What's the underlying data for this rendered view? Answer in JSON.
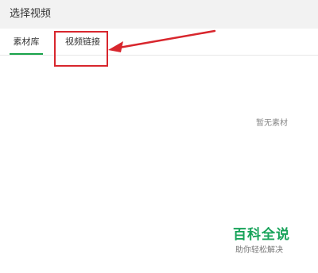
{
  "dialog": {
    "title": "选择视频"
  },
  "tabs": [
    {
      "label": "素材库",
      "active": true
    },
    {
      "label": "视频链接",
      "active": false
    }
  ],
  "content": {
    "empty_text": "暂无素材"
  },
  "annotation": {
    "color": "#d8262d",
    "highlight_target": "视频链接"
  },
  "watermark": {
    "title": "百科全说",
    "subtitle": "助你轻松解决",
    "color": "#18a35a"
  },
  "colors": {
    "active_tab_underline": "#19a34a",
    "title_bar_bg": "#f2f2f2"
  }
}
